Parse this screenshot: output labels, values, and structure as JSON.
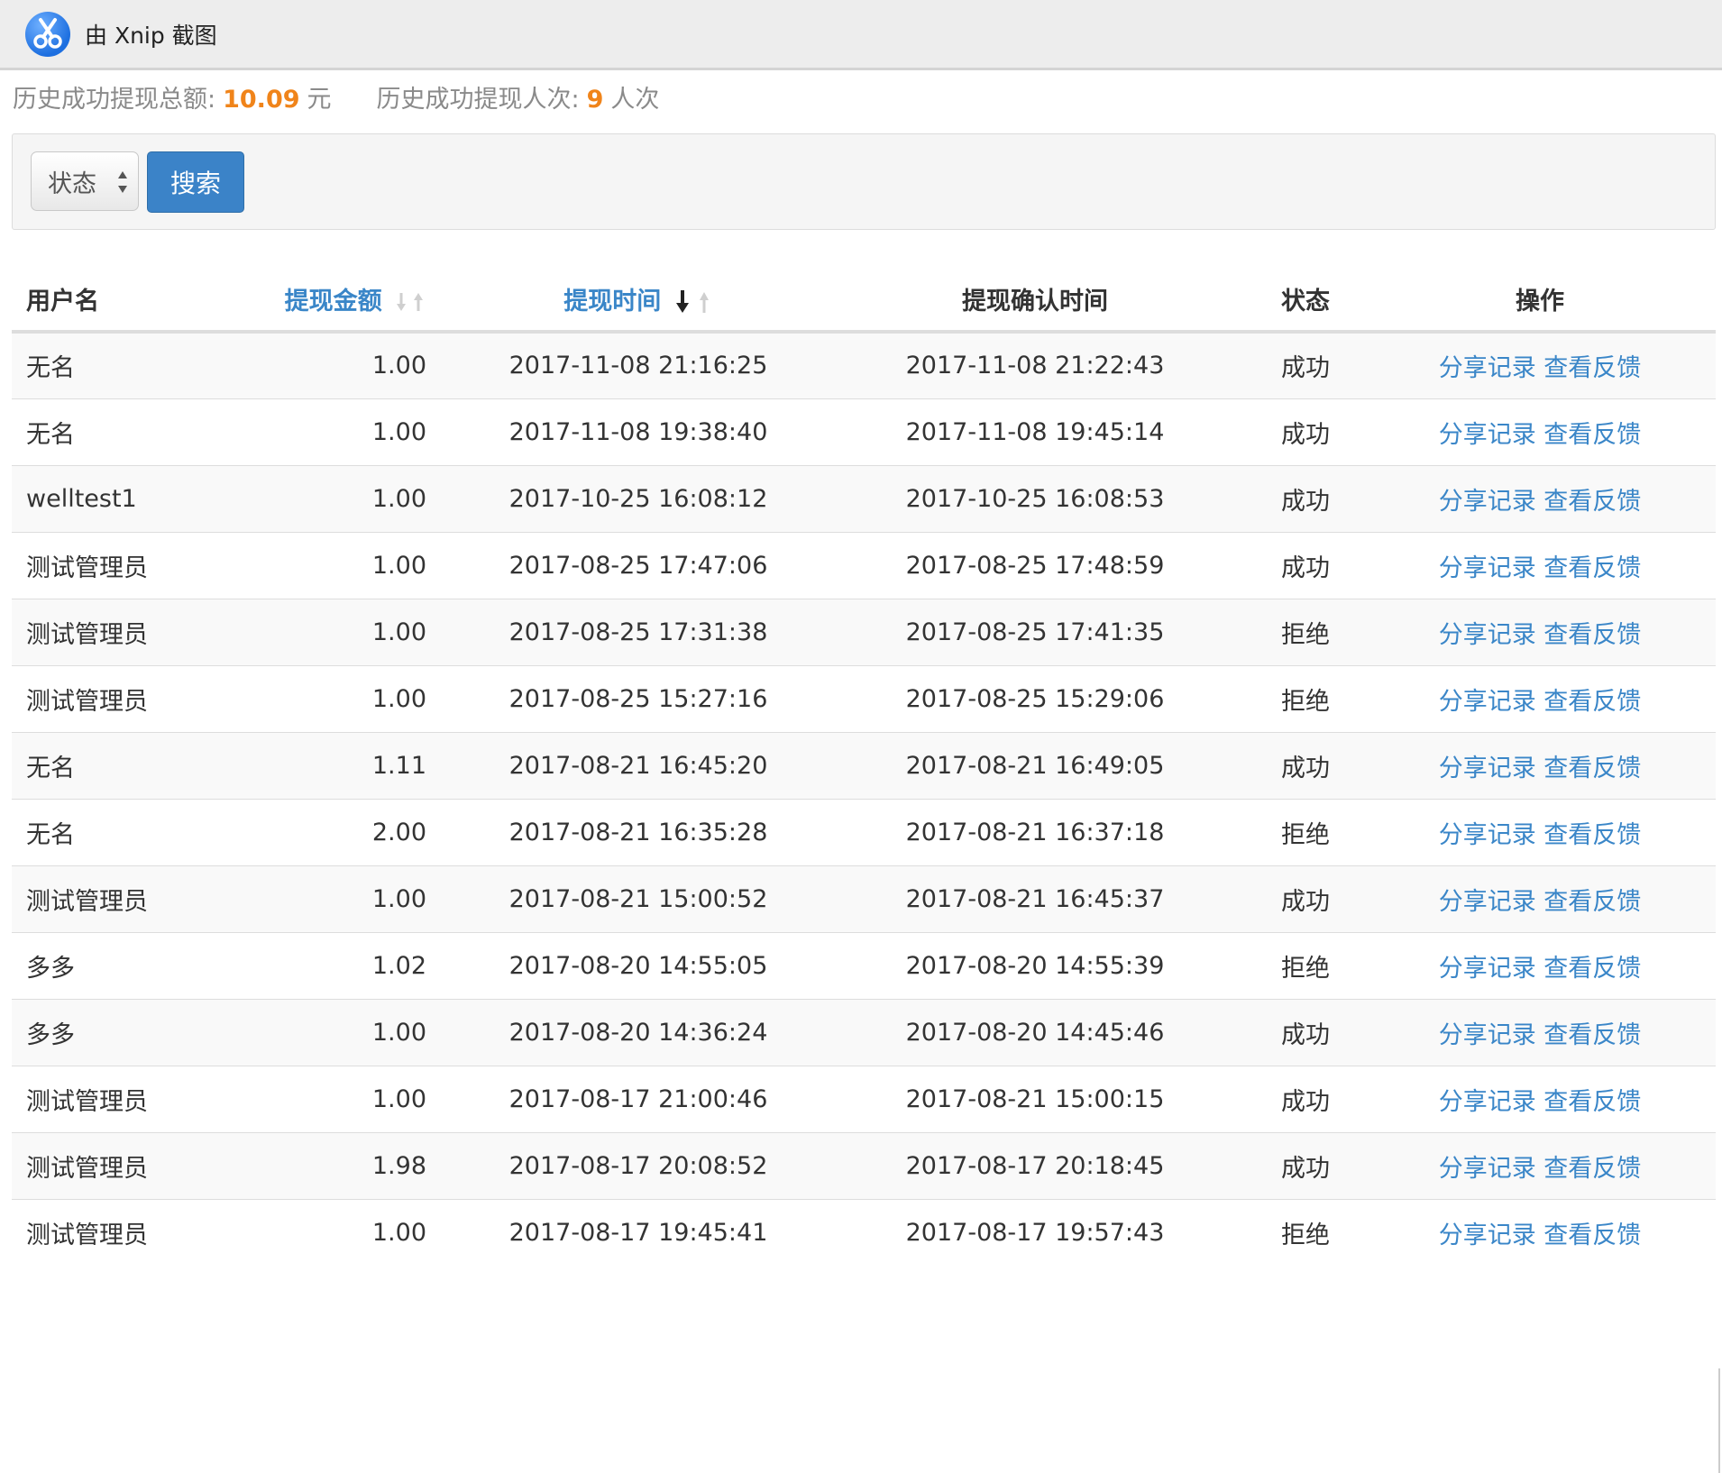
{
  "topbar": {
    "logo_icon": "xnip-scissors-icon",
    "title": "由 Xnip 截图"
  },
  "summary": {
    "total_label": "历史成功提现总额:",
    "total_value": "10.09",
    "total_unit": "元",
    "count_label": "历史成功提现人次:",
    "count_value": "9",
    "count_unit": "人次"
  },
  "filter": {
    "status_select": "状态",
    "search_button": "搜索"
  },
  "colors": {
    "accent": "#3a86c8",
    "success": "#5cb85c",
    "rejected": "#d9534f",
    "highlight": "#f0841a"
  },
  "table": {
    "headers": {
      "user": "用户名",
      "amount": "提现金额",
      "time": "提现时间",
      "confirm_time": "提现确认时间",
      "status": "状态",
      "ops": "操作"
    },
    "rows": [
      {
        "user": "无名",
        "amount": "1.00",
        "time": "2017-11-08 21:16:25",
        "confirm_time": "2017-11-08 21:22:43",
        "status": "成功",
        "ok": true,
        "op_share": "分享记录",
        "op_feedback": "查看反馈"
      },
      {
        "user": "无名",
        "amount": "1.00",
        "time": "2017-11-08 19:38:40",
        "confirm_time": "2017-11-08 19:45:14",
        "status": "成功",
        "ok": true,
        "op_share": "分享记录",
        "op_feedback": "查看反馈"
      },
      {
        "user": "welltest1",
        "amount": "1.00",
        "time": "2017-10-25 16:08:12",
        "confirm_time": "2017-10-25 16:08:53",
        "status": "成功",
        "ok": true,
        "op_share": "分享记录",
        "op_feedback": "查看反馈"
      },
      {
        "user": "测试管理员",
        "amount": "1.00",
        "time": "2017-08-25 17:47:06",
        "confirm_time": "2017-08-25 17:48:59",
        "status": "成功",
        "ok": true,
        "op_share": "分享记录",
        "op_feedback": "查看反馈"
      },
      {
        "user": "测试管理员",
        "amount": "1.00",
        "time": "2017-08-25 17:31:38",
        "confirm_time": "2017-08-25 17:41:35",
        "status": "拒绝",
        "ok": false,
        "op_share": "分享记录",
        "op_feedback": "查看反馈"
      },
      {
        "user": "测试管理员",
        "amount": "1.00",
        "time": "2017-08-25 15:27:16",
        "confirm_time": "2017-08-25 15:29:06",
        "status": "拒绝",
        "ok": false,
        "op_share": "分享记录",
        "op_feedback": "查看反馈"
      },
      {
        "user": "无名",
        "amount": "1.11",
        "time": "2017-08-21 16:45:20",
        "confirm_time": "2017-08-21 16:49:05",
        "status": "成功",
        "ok": true,
        "op_share": "分享记录",
        "op_feedback": "查看反馈"
      },
      {
        "user": "无名",
        "amount": "2.00",
        "time": "2017-08-21 16:35:28",
        "confirm_time": "2017-08-21 16:37:18",
        "status": "拒绝",
        "ok": false,
        "op_share": "分享记录",
        "op_feedback": "查看反馈"
      },
      {
        "user": "测试管理员",
        "amount": "1.00",
        "time": "2017-08-21 15:00:52",
        "confirm_time": "2017-08-21 16:45:37",
        "status": "成功",
        "ok": true,
        "op_share": "分享记录",
        "op_feedback": "查看反馈"
      },
      {
        "user": "多多",
        "amount": "1.02",
        "time": "2017-08-20 14:55:05",
        "confirm_time": "2017-08-20 14:55:39",
        "status": "拒绝",
        "ok": false,
        "op_share": "分享记录",
        "op_feedback": "查看反馈"
      },
      {
        "user": "多多",
        "amount": "1.00",
        "time": "2017-08-20 14:36:24",
        "confirm_time": "2017-08-20 14:45:46",
        "status": "成功",
        "ok": true,
        "op_share": "分享记录",
        "op_feedback": "查看反馈"
      },
      {
        "user": "测试管理员",
        "amount": "1.00",
        "time": "2017-08-17 21:00:46",
        "confirm_time": "2017-08-21 15:00:15",
        "status": "成功",
        "ok": true,
        "op_share": "分享记录",
        "op_feedback": "查看反馈"
      },
      {
        "user": "测试管理员",
        "amount": "1.98",
        "time": "2017-08-17 20:08:52",
        "confirm_time": "2017-08-17 20:18:45",
        "status": "成功",
        "ok": true,
        "op_share": "分享记录",
        "op_feedback": "查看反馈"
      },
      {
        "user": "测试管理员",
        "amount": "1.00",
        "time": "2017-08-17 19:45:41",
        "confirm_time": "2017-08-17 19:57:43",
        "status": "拒绝",
        "ok": false,
        "op_share": "分享记录",
        "op_feedback": "查看反馈"
      }
    ]
  }
}
